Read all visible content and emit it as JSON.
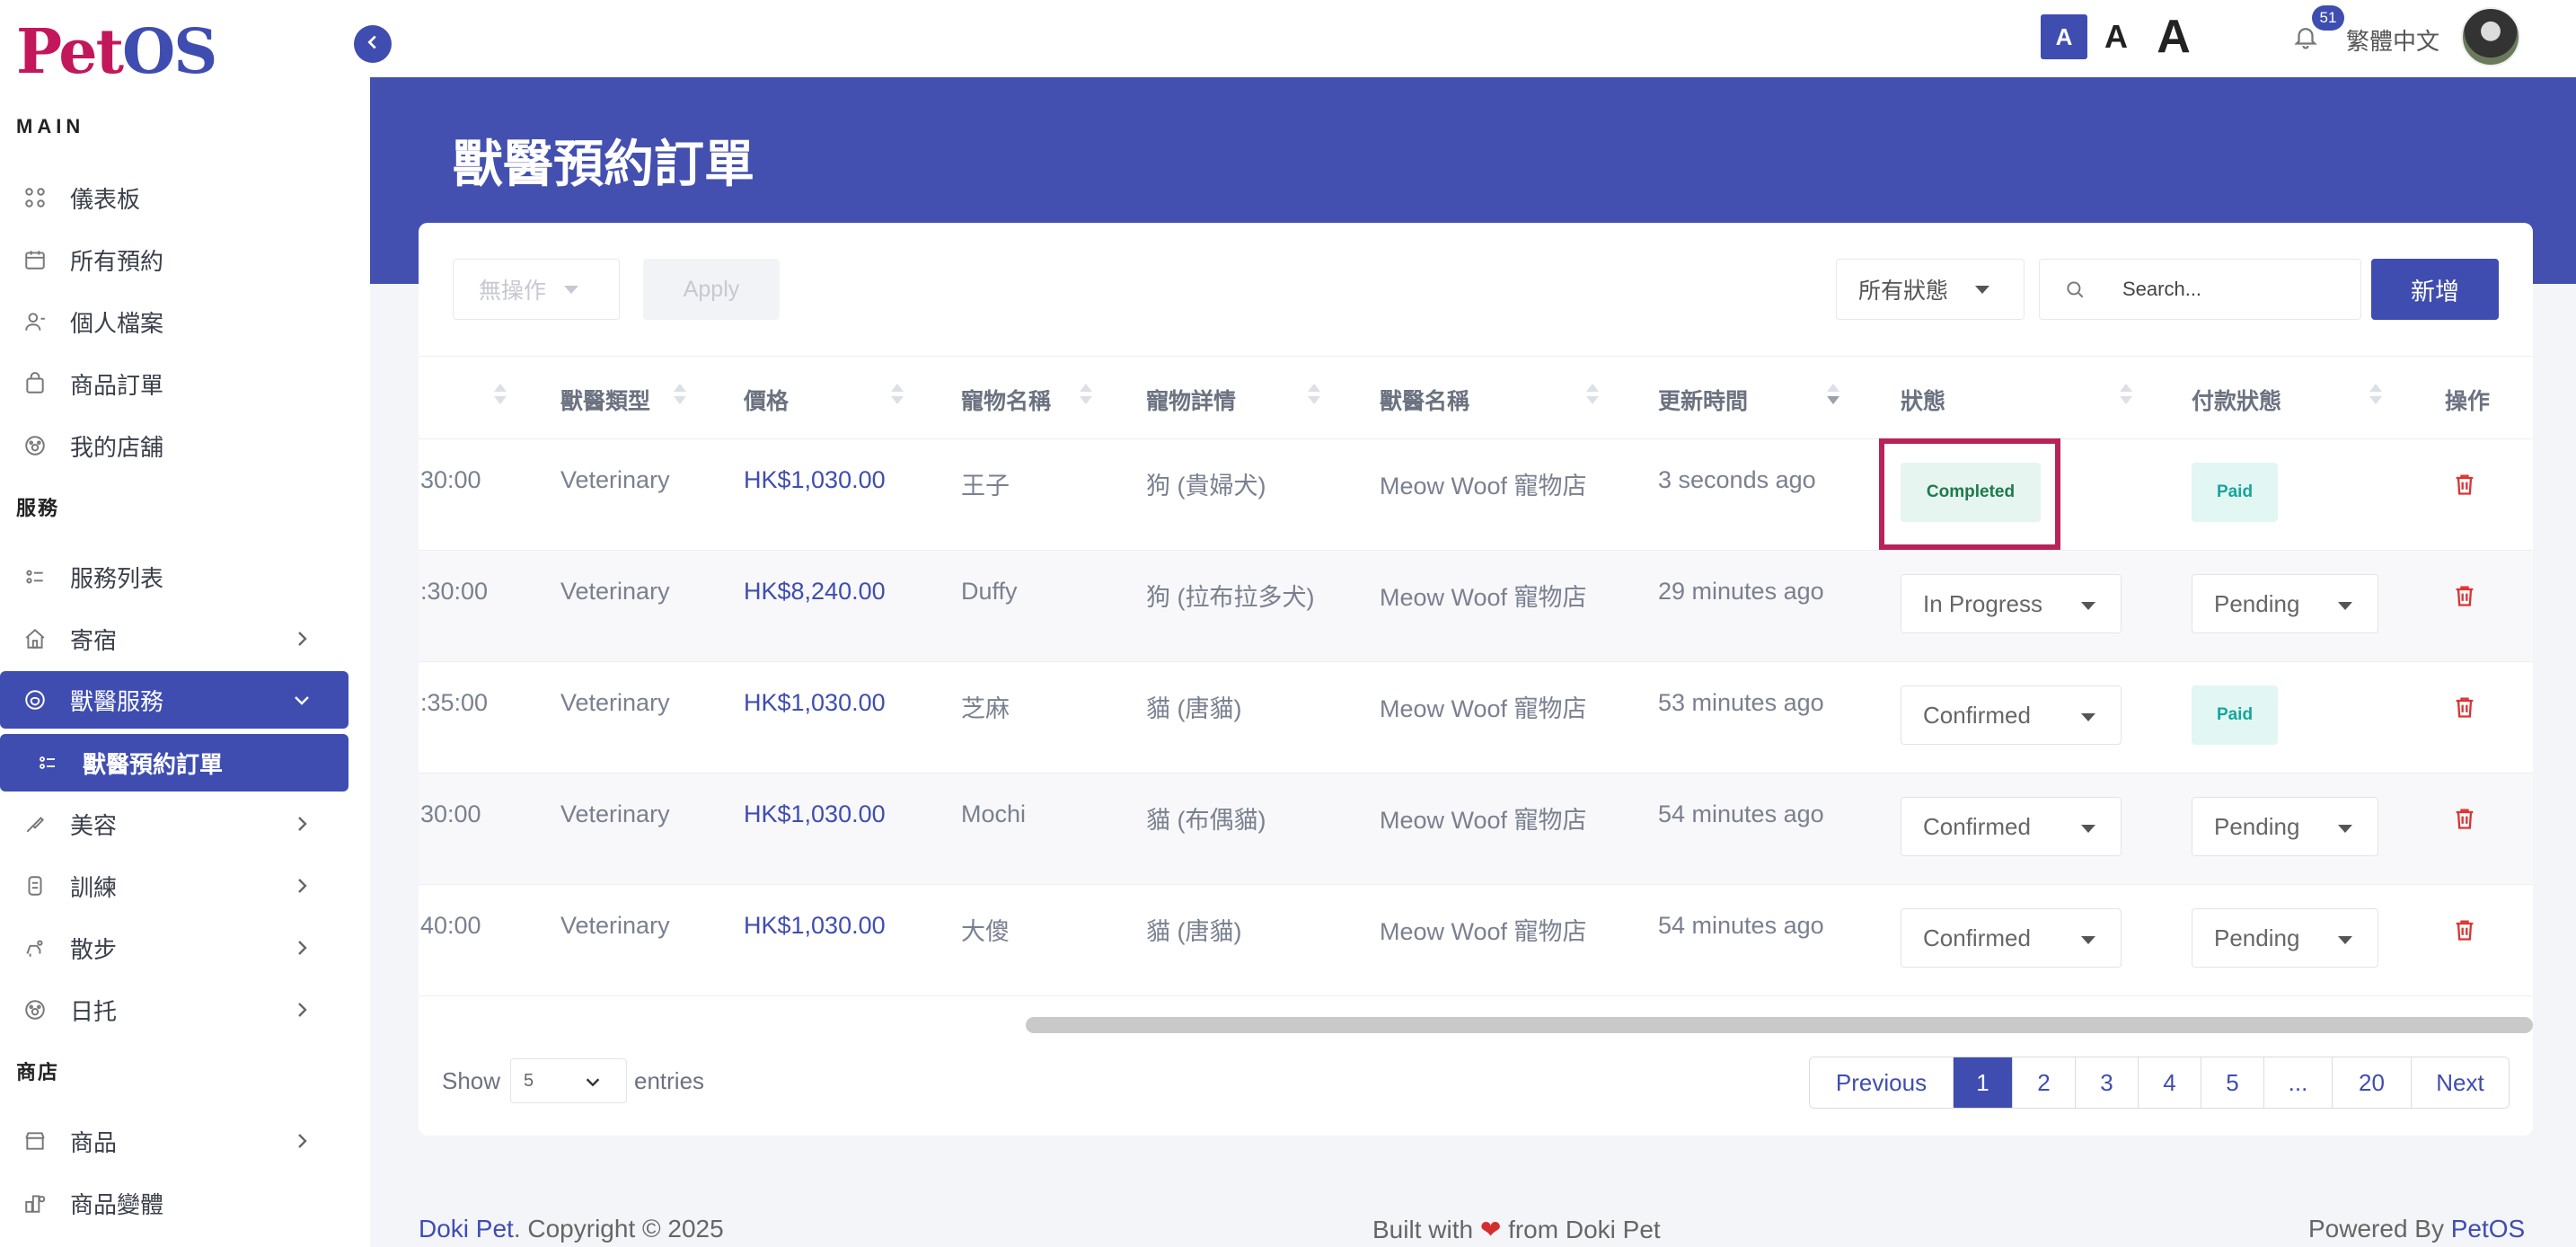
{
  "brand": {
    "part1": "Pet",
    "part2": "OS"
  },
  "sidebar": {
    "section_main": "MAIN",
    "section_services": "服務",
    "section_store": "商店",
    "items": [
      {
        "label": "儀表板"
      },
      {
        "label": "所有預約"
      },
      {
        "label": "個人檔案"
      },
      {
        "label": "商品訂單"
      },
      {
        "label": "我的店舖"
      },
      {
        "label": "服務列表"
      },
      {
        "label": "寄宿"
      },
      {
        "label": "獸醫服務"
      },
      {
        "label": "獸醫預約訂單"
      },
      {
        "label": "美容"
      },
      {
        "label": "訓練"
      },
      {
        "label": "散步"
      },
      {
        "label": "日托"
      },
      {
        "label": "商品"
      },
      {
        "label": "商品變體"
      }
    ]
  },
  "topbar": {
    "font_small": "A",
    "font_medium": "A",
    "font_large": "A",
    "notification_count": "51",
    "language": "繁體中文"
  },
  "page": {
    "title": "獸醫預約訂單"
  },
  "toolbar": {
    "bulk_action": "無操作",
    "apply": "Apply",
    "status_filter": "所有狀態",
    "search_placeholder": "Search...",
    "add": "新增"
  },
  "table": {
    "headers": [
      "獸醫類型",
      "價格",
      "寵物名稱",
      "寵物詳情",
      "獸醫名稱",
      "更新時間",
      "狀態",
      "付款狀態",
      "操作"
    ],
    "rows": [
      {
        "time": "30:00",
        "type": "Veterinary",
        "price": "HK$1,030.00",
        "pet": "王子",
        "detail": "狗 (貴婦犬)",
        "vet": "Meow Woof 寵物店",
        "updated": "3 seconds ago",
        "status": "Completed",
        "payment": "Paid"
      },
      {
        "time": ":30:00",
        "type": "Veterinary",
        "price": "HK$8,240.00",
        "pet": "Duffy",
        "detail": "狗 (拉布拉多犬)",
        "vet": "Meow Woof 寵物店",
        "updated": "29 minutes ago",
        "status": "In Progress",
        "payment": "Pending"
      },
      {
        "time": ":35:00",
        "type": "Veterinary",
        "price": "HK$1,030.00",
        "pet": "芝麻",
        "detail": "貓 (唐貓)",
        "vet": "Meow Woof 寵物店",
        "updated": "53 minutes ago",
        "status": "Confirmed",
        "payment": "Paid"
      },
      {
        "time": "30:00",
        "type": "Veterinary",
        "price": "HK$1,030.00",
        "pet": "Mochi",
        "detail": "貓 (布偶貓)",
        "vet": "Meow Woof 寵物店",
        "updated": "54 minutes ago",
        "status": "Confirmed",
        "payment": "Pending"
      },
      {
        "time": "40:00",
        "type": "Veterinary",
        "price": "HK$1,030.00",
        "pet": "大傻",
        "detail": "貓 (唐貓)",
        "vet": "Meow Woof 寵物店",
        "updated": "54 minutes ago",
        "status": "Confirmed",
        "payment": "Pending"
      }
    ]
  },
  "pagination": {
    "show_label": "Show",
    "page_length": "5",
    "entries_label": "entries",
    "previous": "Previous",
    "pages": [
      "1",
      "2",
      "3",
      "4",
      "5",
      "...",
      "20"
    ],
    "next": "Next"
  },
  "footer": {
    "brand": "Doki Pet",
    "copyright": ". Copyright © 2025",
    "built_prefix": "Built with",
    "built_suffix": "from Doki Pet",
    "powered_prefix": "Powered By",
    "powered_brand": "PetOS"
  }
}
